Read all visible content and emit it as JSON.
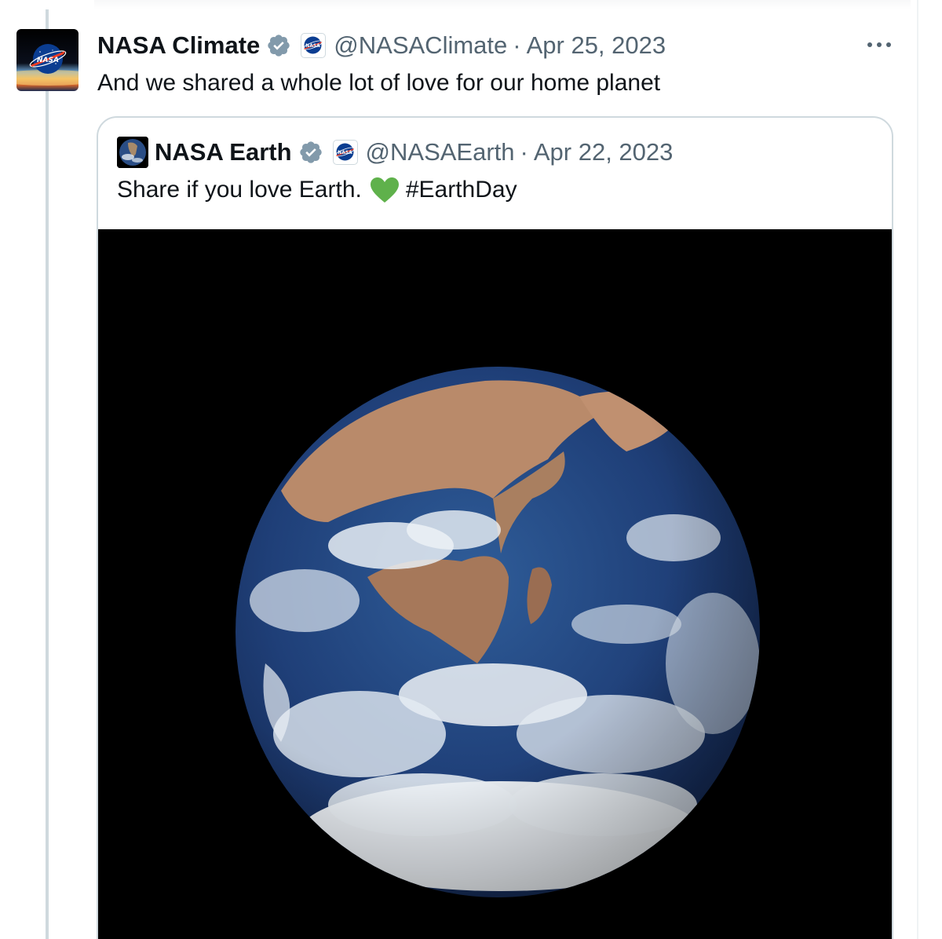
{
  "tweet": {
    "author_name": "NASA Climate",
    "handle": "@NASAClimate",
    "separator": "·",
    "date": "Apr 25, 2023",
    "text": "And we shared a whole lot of love for our home planet",
    "avatar_logo_text": "NASA"
  },
  "quoted_tweet": {
    "author_name": "NASA Earth",
    "handle": "@NASAEarth",
    "separator": "·",
    "date": "Apr 22, 2023",
    "text": "Share if you love Earth.",
    "emoji": "green-heart",
    "hashtag": "#EarthDay"
  },
  "icons": {
    "verified": "verified-badge-icon",
    "affiliate": "nasa-affiliate-icon",
    "more": "more-options-icon",
    "heart": "green-heart-icon"
  },
  "colors": {
    "text_primary": "#0f1419",
    "text_secondary": "#536471",
    "border": "#cfd9de",
    "verified_badge": "#829aab",
    "heart": "#5fb14b",
    "nasa_blue": "#0b3d91",
    "nasa_red": "#fc3d21"
  }
}
